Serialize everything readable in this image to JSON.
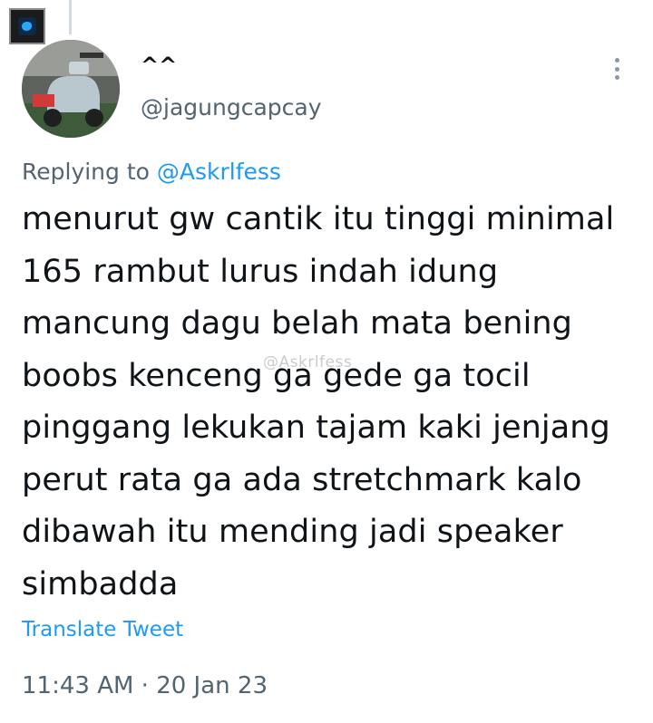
{
  "tweet": {
    "display_name": "^^",
    "handle": "@jagungcapcay",
    "replying_prefix": "Replying to ",
    "replying_to": "@Askrlfess",
    "text": "menurut gw cantik itu tinggi minimal 165 rambut lurus indah idung mancung dagu belah mata bening boobs kenceng ga gede ga tocil pinggang lekukan tajam kaki jenjang perut rata ga ada stretchmark kalo dibawah itu mending jadi speaker simbadda",
    "watermark": "@Askrlfess",
    "translate_label": "Translate Tweet",
    "timestamp": "11:43 AM · 20 Jan 23"
  },
  "icons": {
    "corner": "app-icon",
    "more": "more-options-icon",
    "avatar": "user-avatar-scooter-photo"
  }
}
